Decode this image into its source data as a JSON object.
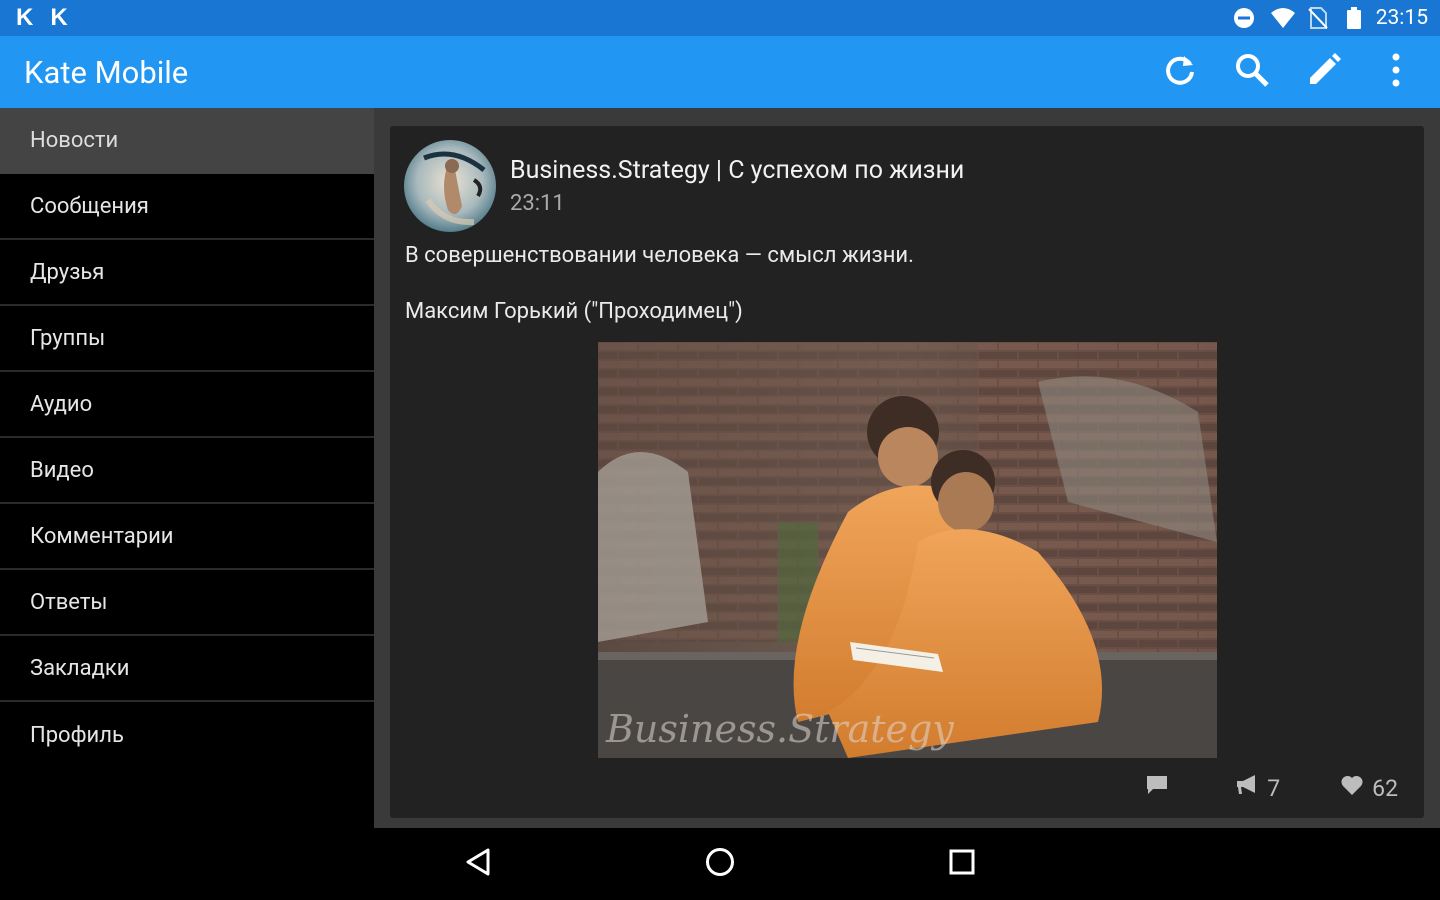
{
  "status_bar": {
    "left_icons": [
      "K",
      "K"
    ],
    "time": "23:15",
    "icons": [
      "do-not-disturb-icon",
      "wifi-icon",
      "no-sim-icon",
      "battery-icon"
    ]
  },
  "action_bar": {
    "title": "Kate Mobile",
    "actions": [
      "refresh-icon",
      "search-icon",
      "edit-icon",
      "overflow-menu-icon"
    ],
    "color": "#2196f3"
  },
  "sidebar": {
    "items": [
      {
        "label": "Новости",
        "active": true
      },
      {
        "label": "Сообщения"
      },
      {
        "label": "Друзья"
      },
      {
        "label": "Группы"
      },
      {
        "label": "Аудио"
      },
      {
        "label": "Видео"
      },
      {
        "label": "Комментарии"
      },
      {
        "label": "Ответы"
      },
      {
        "label": "Закладки"
      },
      {
        "label": "Профиль"
      }
    ]
  },
  "post": {
    "author": "Business.Strategy | С успехом по жизни",
    "time": "23:11",
    "text_line_1": "В совершенствовании человека — смысл жизни.",
    "text_line_2": "Максим Горький (\"Проходимец\")",
    "image_watermark": "Business.Strategy",
    "reposts": "7",
    "likes": "62"
  },
  "nav_bar": {
    "buttons": [
      "back-icon",
      "home-icon",
      "recent-apps-icon"
    ]
  }
}
